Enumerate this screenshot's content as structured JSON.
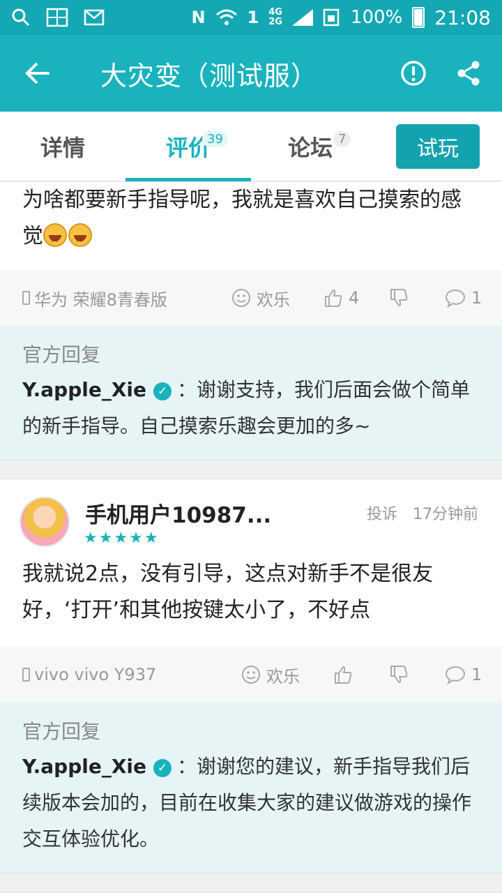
{
  "statusbar": {
    "network_4g": "4G",
    "network_2g": "2G",
    "battery": "100%",
    "time": "21:08"
  },
  "titlebar": {
    "title": "大灾变（测试服）"
  },
  "tabs": [
    {
      "label": "详情",
      "count": ""
    },
    {
      "label": "评价",
      "count": "39"
    },
    {
      "label": "论坛",
      "count": "7"
    }
  ],
  "try_button": "试玩",
  "review1": {
    "text": "为啥都要新手指导呢，我就是喜欢自己摸索的感觉",
    "device": "华为 荣耀8青春版",
    "mood": "欢乐",
    "likes": "4",
    "comments": "1",
    "reply_title": "官方回复",
    "reply_user": "Y.apple_Xie",
    "reply_text": "：谢谢支持，我们后面会做个简单的新手指导。自己摸索乐趣会更加的多~"
  },
  "review2": {
    "username": "手机用户10987...",
    "report": "投诉",
    "time": "17分钟前",
    "rating": 5,
    "stars": "★★★★★",
    "text": "我就说2点，没有引导，这点对新手不是很友好，‘打开’和其他按键太小了，不好点",
    "device": "vivo vivo Y937",
    "mood": "欢乐",
    "comments": "1",
    "reply_title": "官方回复",
    "reply_user": "Y.apple_Xie",
    "reply_text": "：谢谢您的建议，新手指导我们后续版本会加的，目前在收集大家的建议做游戏的操作交互体验优化。"
  },
  "colors": {
    "accent": "#19b2bd",
    "statusbar": "#13a8b4",
    "reply_bg": "#e6f4f5"
  }
}
